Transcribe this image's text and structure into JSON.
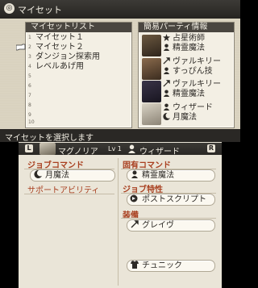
{
  "title": "マイセット",
  "set_list": {
    "heading": "マイセットリスト",
    "items": [
      {
        "num": "1",
        "name": "マイセット１"
      },
      {
        "num": "2",
        "name": "マイセット２"
      },
      {
        "num": "3",
        "name": "ダンジョン探索用"
      },
      {
        "num": "4",
        "name": "レベルあげ用"
      },
      {
        "num": "5",
        "name": ""
      },
      {
        "num": "6",
        "name": ""
      },
      {
        "num": "7",
        "name": ""
      },
      {
        "num": "8",
        "name": ""
      },
      {
        "num": "9",
        "name": ""
      },
      {
        "num": "10",
        "name": ""
      }
    ]
  },
  "party": {
    "heading": "簡易パーティ情報",
    "members": [
      {
        "job": "占星術師",
        "sub": "精霊魔法",
        "job_icon": "star-icon",
        "sub_icon": "spirit-icon"
      },
      {
        "job": "ヴァルキリー",
        "sub": "すっぴん技",
        "job_icon": "spear-icon",
        "sub_icon": "spirit-icon"
      },
      {
        "job": "ヴァルキリー",
        "sub": "精霊魔法",
        "job_icon": "spear-icon",
        "sub_icon": "spirit-icon"
      },
      {
        "job": "ウィザード",
        "sub": "月魔法",
        "job_icon": "spirit-icon",
        "sub_icon": "moon-icon"
      }
    ]
  },
  "prompt": "マイセットを選択します",
  "character": {
    "l_button": "L",
    "r_button": "R",
    "name": "マグノリア",
    "lv_label": "Lv",
    "level": "1",
    "job": "ウィザード"
  },
  "details": {
    "job_command_label": "ジョブコマンド",
    "job_command": "月魔法",
    "support_label": "サポートアビリティ",
    "innate_command_label": "固有コマンド",
    "innate_command": "精霊魔法",
    "job_trait_label": "ジョブ特性",
    "job_trait": "ポストスクリプト",
    "equip_label": "装備",
    "weapon": "グレイヴ",
    "armor": "チュニック"
  },
  "colors": {
    "accent": "#a83f1f",
    "bar": "#2a2825",
    "panel": "#f3efe4"
  }
}
